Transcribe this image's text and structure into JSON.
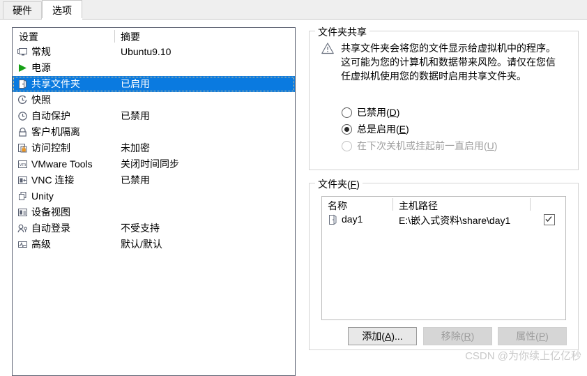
{
  "tabs": [
    {
      "id": "hardware",
      "label": "硬件",
      "active": false
    },
    {
      "id": "options",
      "label": "选项",
      "active": true
    }
  ],
  "settings_list": {
    "headers": {
      "setting": "设置",
      "summary": "摘要"
    },
    "rows": [
      {
        "icon": "monitor-icon",
        "label": "常规",
        "summary": "Ubuntu9.10",
        "selected": false
      },
      {
        "icon": "play-triangle-icon",
        "label": "电源",
        "summary": "",
        "selected": false
      },
      {
        "icon": "shared-folder-icon",
        "label": "共享文件夹",
        "summary": "已启用",
        "selected": true
      },
      {
        "icon": "snapshot-clock-icon",
        "label": "快照",
        "summary": "",
        "selected": false
      },
      {
        "icon": "autoprotect-clock-icon",
        "label": "自动保护",
        "summary": "已禁用",
        "selected": false
      },
      {
        "icon": "lock-icon",
        "label": "客户机隔离",
        "summary": "",
        "selected": false
      },
      {
        "icon": "access-control-icon",
        "label": "访问控制",
        "summary": "未加密",
        "selected": false
      },
      {
        "icon": "vmware-tools-icon",
        "label": "VMware Tools",
        "summary": "关闭时间同步",
        "selected": false
      },
      {
        "icon": "vnc-icon",
        "label": "VNC 连接",
        "summary": "已禁用",
        "selected": false
      },
      {
        "icon": "unity-icon",
        "label": "Unity",
        "summary": "",
        "selected": false
      },
      {
        "icon": "device-view-icon",
        "label": "设备视图",
        "summary": "",
        "selected": false
      },
      {
        "icon": "auto-login-icon",
        "label": "自动登录",
        "summary": "不受支持",
        "selected": false
      },
      {
        "icon": "advanced-icon",
        "label": "高级",
        "summary": "默认/默认",
        "selected": false
      }
    ]
  },
  "folder_sharing": {
    "legend": "文件夹共享",
    "warning_text": "共享文件夹会将您的文件显示给虚拟机中的程序。这可能为您的计算机和数据带来风险。请仅在您信任虚拟机使用您的数据时启用共享文件夹。",
    "options": [
      {
        "id": "disabled",
        "label": "已禁用(",
        "accel": "D",
        "label_tail": ")",
        "checked": false,
        "enabled": true
      },
      {
        "id": "always",
        "label": "总是启用(",
        "accel": "E",
        "label_tail": ")",
        "checked": true,
        "enabled": true
      },
      {
        "id": "until",
        "label": "在下次关机或挂起前一直启用(",
        "accel": "U",
        "label_tail": ")",
        "checked": false,
        "enabled": false
      }
    ]
  },
  "folders": {
    "legend": "文件夹(",
    "legend_accel": "F",
    "legend_tail": ")",
    "columns": {
      "name": "名称",
      "host_path": "主机路径",
      "enabled": ""
    },
    "rows": [
      {
        "icon": "shared-folder-icon",
        "name": "day1",
        "host_path": "E:\\嵌入式资料\\share\\day1",
        "enabled": true
      }
    ],
    "buttons": [
      {
        "id": "add",
        "label": "添加(",
        "accel": "A",
        "label_tail": ")...",
        "enabled": true
      },
      {
        "id": "remove",
        "label": "移除(",
        "accel": "R",
        "label_tail": ")",
        "enabled": false
      },
      {
        "id": "property",
        "label": "属性(",
        "accel": "P",
        "label_tail": ")",
        "enabled": false
      }
    ]
  },
  "watermark": "CSDN @为你续上亿亿秒",
  "colors": {
    "selection_blue": "#0a7ae0",
    "panel_border": "#5a6070",
    "group_border": "#d4d4d4",
    "disabled_text": "#a0a0a0",
    "watermark": "#c9c9c9"
  }
}
